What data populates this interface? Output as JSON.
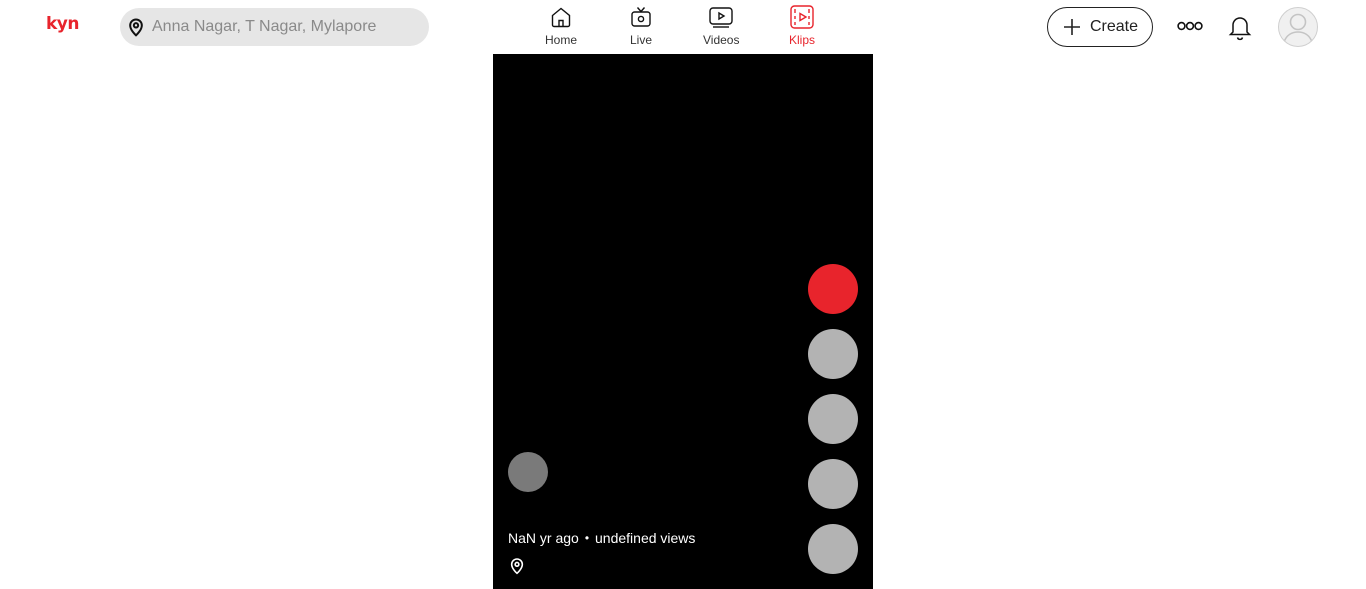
{
  "brand": {
    "logo_text": "kyn",
    "accent_color": "#e8242c"
  },
  "search": {
    "placeholder": "Anna Nagar, T Nagar, Mylapore",
    "icon": "location-pin-icon"
  },
  "nav": {
    "items": [
      {
        "label": "Home",
        "icon": "home-icon",
        "active": false
      },
      {
        "label": "Live",
        "icon": "tv-icon",
        "active": false
      },
      {
        "label": "Videos",
        "icon": "play-square-icon",
        "active": false
      },
      {
        "label": "Klips",
        "icon": "film-play-icon",
        "active": true
      }
    ]
  },
  "header_actions": {
    "create_label": "Create",
    "more_icon": "more-icon",
    "bell_icon": "bell-icon",
    "avatar_icon": "user-avatar-icon"
  },
  "player": {
    "time_ago": "NaN yr ago",
    "separator": "•",
    "views": "undefined views",
    "location_icon": "location-pin-icon",
    "action_colors": {
      "primary": "#e8242c",
      "secondary": "#b3b3b3"
    }
  }
}
